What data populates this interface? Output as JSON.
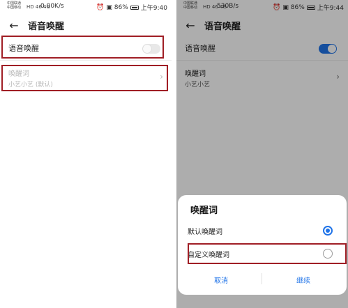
{
  "left": {
    "status": {
      "carrier_line1": "中国联通",
      "carrier_line2": "中国移动",
      "network": "HD 46 4G",
      "speed": "0.00K/s",
      "icons": "⏰ ▣ 86%",
      "time": "上午9:40"
    },
    "appbar": {
      "back_icon": "←",
      "title": "语音唤醒"
    },
    "voice_wake": {
      "label": "语音唤醒",
      "enabled": false
    },
    "wake_word": {
      "title": "唤醒词",
      "subtitle": "小艺小艺 (默认)",
      "chevron": "›"
    }
  },
  "right": {
    "status": {
      "carrier_line1": "中国联通",
      "carrier_line2": "中国移动",
      "network": "HD 46 4G",
      "speed": "530B/s",
      "icons": "⏰ ▣ 86%",
      "time": "上午9:44"
    },
    "appbar": {
      "back_icon": "←",
      "title": "语音唤醒"
    },
    "voice_wake": {
      "label": "语音唤醒",
      "enabled": true
    },
    "wake_word": {
      "title": "唤醒词",
      "subtitle": "小艺小艺",
      "chevron": "›"
    },
    "dialog": {
      "title": "唤醒词",
      "options": [
        {
          "label": "默认唤醒词",
          "selected": true
        },
        {
          "label": "自定义唤醒词",
          "selected": false
        }
      ],
      "cancel_label": "取消",
      "continue_label": "继续"
    }
  },
  "colors": {
    "accent": "#1f73e8",
    "highlight": "#a01e25",
    "dim_text": "#b8b8b8"
  }
}
